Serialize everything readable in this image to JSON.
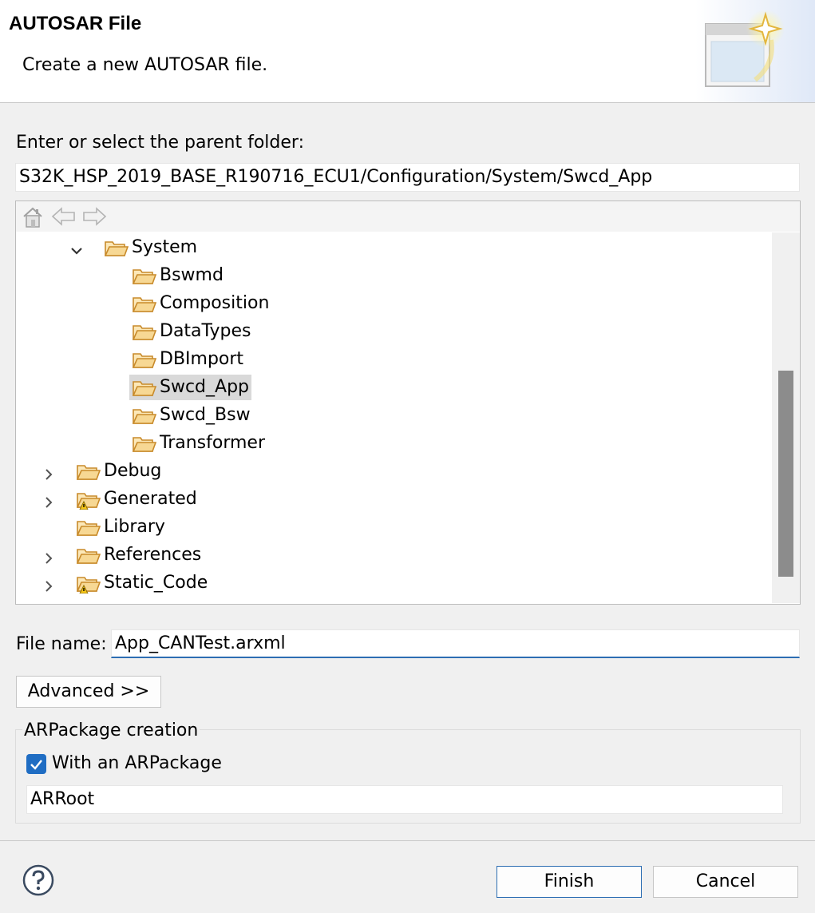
{
  "header": {
    "title": "AUTOSAR File",
    "description": "Create a new AUTOSAR file.",
    "icon": "new-file-wizard-icon"
  },
  "parent_folder": {
    "label": "Enter or select the parent folder:",
    "value": "S32K_HSP_2019_BASE_R190716_ECU1/Configuration/System/Swcd_App"
  },
  "tree_toolbar": {
    "home": "home-icon",
    "back": "back-arrow-icon",
    "forward": "forward-arrow-icon"
  },
  "tree": {
    "items": [
      {
        "label": "System",
        "expanded": true
      },
      {
        "label": "Bswmd"
      },
      {
        "label": "Composition"
      },
      {
        "label": "DataTypes"
      },
      {
        "label": "DBImport"
      },
      {
        "label": "Swcd_App",
        "selected": true
      },
      {
        "label": "Swcd_Bsw"
      },
      {
        "label": "Transformer"
      },
      {
        "label": "Debug",
        "expanded": false
      },
      {
        "label": "Generated",
        "expanded": false,
        "warning": true
      },
      {
        "label": "Library"
      },
      {
        "label": "References",
        "expanded": false
      },
      {
        "label": "Static_Code",
        "expanded": false,
        "warning": true
      }
    ]
  },
  "file_name": {
    "label": "File name:",
    "value": "App_CANTest.arxml"
  },
  "advanced_button": "Advanced >>",
  "arpackage": {
    "group_label": "ARPackage creation",
    "checkbox_label": "With an ARPackage",
    "checked": true,
    "value": "ARRoot"
  },
  "footer": {
    "finish": "Finish",
    "cancel": "Cancel",
    "help": "help-icon"
  },
  "colors": {
    "accent": "#1f6dc3",
    "selection": "#d9d9d9",
    "folder": "#e8a93a"
  }
}
